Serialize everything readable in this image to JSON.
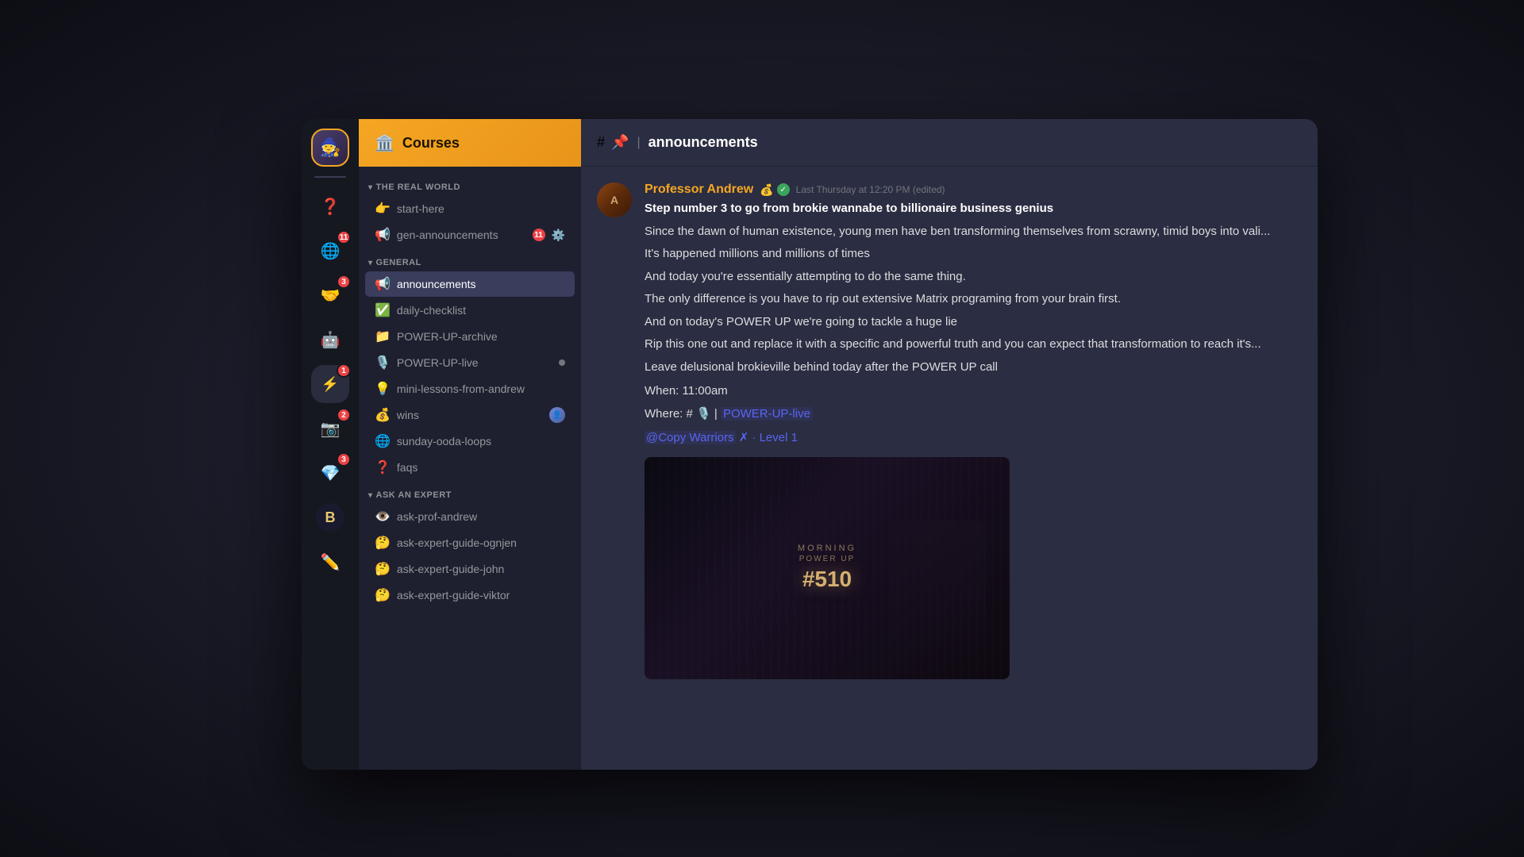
{
  "app": {
    "title": "The Real World"
  },
  "iconBar": {
    "items": [
      {
        "id": "main-server",
        "emoji": "🧙",
        "active": false,
        "badge": null
      },
      {
        "id": "help",
        "emoji": "❓",
        "active": false,
        "badge": null
      },
      {
        "id": "globe",
        "emoji": "🌐",
        "active": false,
        "badge": "11"
      },
      {
        "id": "handshake",
        "emoji": "🤝",
        "active": false,
        "badge": "3"
      },
      {
        "id": "robot",
        "emoji": "🤖",
        "active": false,
        "badge": null
      },
      {
        "id": "trw-logo",
        "emoji": "⚡",
        "active": true,
        "badge": "1"
      },
      {
        "id": "camera",
        "emoji": "📷",
        "active": false,
        "badge": "2"
      },
      {
        "id": "diamond",
        "emoji": "💎",
        "active": false,
        "badge": "3"
      },
      {
        "id": "b-icon",
        "emoji": "🅱",
        "active": false,
        "badge": null
      },
      {
        "id": "pen",
        "emoji": "✏️",
        "active": false,
        "badge": null
      }
    ]
  },
  "sidebar": {
    "coursesLabel": "Courses",
    "coursesIcon": "🏛️",
    "categories": [
      {
        "id": "the-real-world",
        "name": "THE REAL WORLD",
        "channels": [
          {
            "id": "start-here",
            "icon": "👉",
            "name": "start-here",
            "badge": null,
            "online": false
          },
          {
            "id": "gen-announcements",
            "icon": "📢",
            "name": "gen-announcements",
            "badge": "11",
            "online": false
          }
        ]
      },
      {
        "id": "general",
        "name": "GENERAL",
        "channels": [
          {
            "id": "announcements",
            "icon": "📢",
            "name": "announcements",
            "badge": null,
            "online": false,
            "active": true
          },
          {
            "id": "daily-checklist",
            "icon": "✅",
            "name": "daily-checklist",
            "badge": null,
            "online": false
          },
          {
            "id": "power-up-archive",
            "icon": "📁",
            "name": "POWER-UP-archive",
            "badge": null,
            "online": false
          },
          {
            "id": "power-up-live",
            "icon": "🎙️",
            "name": "POWER-UP-live",
            "badge": null,
            "online": true
          },
          {
            "id": "mini-lessons",
            "icon": "💡",
            "name": "mini-lessons-from-andrew",
            "badge": null,
            "online": false
          },
          {
            "id": "wins",
            "icon": "💰",
            "name": "wins",
            "badge": null,
            "online": false,
            "hasAvatar": true
          },
          {
            "id": "sunday-ooda-loops",
            "icon": "🌐",
            "name": "sunday-ooda-loops",
            "badge": null,
            "online": false
          },
          {
            "id": "faqs",
            "icon": "❓",
            "name": "faqs",
            "badge": null,
            "online": false
          }
        ]
      },
      {
        "id": "ask-an-expert",
        "name": "ASK AN EXPERT",
        "channels": [
          {
            "id": "ask-prof-andrew",
            "icon": "👁️",
            "name": "ask-prof-andrew",
            "badge": null,
            "online": false
          },
          {
            "id": "ask-ognjen",
            "icon": "🤔",
            "name": "ask-expert-guide-ognjen",
            "badge": null,
            "online": false
          },
          {
            "id": "ask-john",
            "icon": "🤔",
            "name": "ask-expert-guide-john",
            "badge": null,
            "online": false
          },
          {
            "id": "ask-viktor",
            "icon": "🤔",
            "name": "ask-expert-guide-viktor",
            "badge": null,
            "online": false
          }
        ]
      }
    ]
  },
  "channelHeader": {
    "icon": "#",
    "pinIcon": "📌",
    "name": "announcements"
  },
  "message": {
    "author": "Professor Andrew",
    "authorColor": "#f5a623",
    "badge1": "💰",
    "badge2": "✓",
    "timestamp": "Last Thursday at 12:20 PM (edited)",
    "bold": "Step number 3 to go from brokie wannabe to billionaire business genius",
    "paragraphs": [
      "Since the dawn of human existence, young men have ben transforming themselves from scrawny, timid boys into vali...",
      "It's happened millions and millions of times",
      "And today you're essentially attempting to do the same thing.",
      "The only difference is you have to rip out extensive Matrix programing from your brain first.",
      "And on today's POWER UP we're going to tackle a huge lie",
      "Rip this one out and replace it with a specific and powerful truth and you can expect that transformation to reach it's...",
      "Leave delusional brokieville behind today after the POWER UP call"
    ],
    "when": "When: 11:00am",
    "where": "Where: # 🎙️ | POWER-UP-live",
    "mention": "@Copy Warriors",
    "mentionSuffix": "✗ · Level 1",
    "imageTitle": "MORNING",
    "imageSubtitle": "POWER UP #510"
  }
}
